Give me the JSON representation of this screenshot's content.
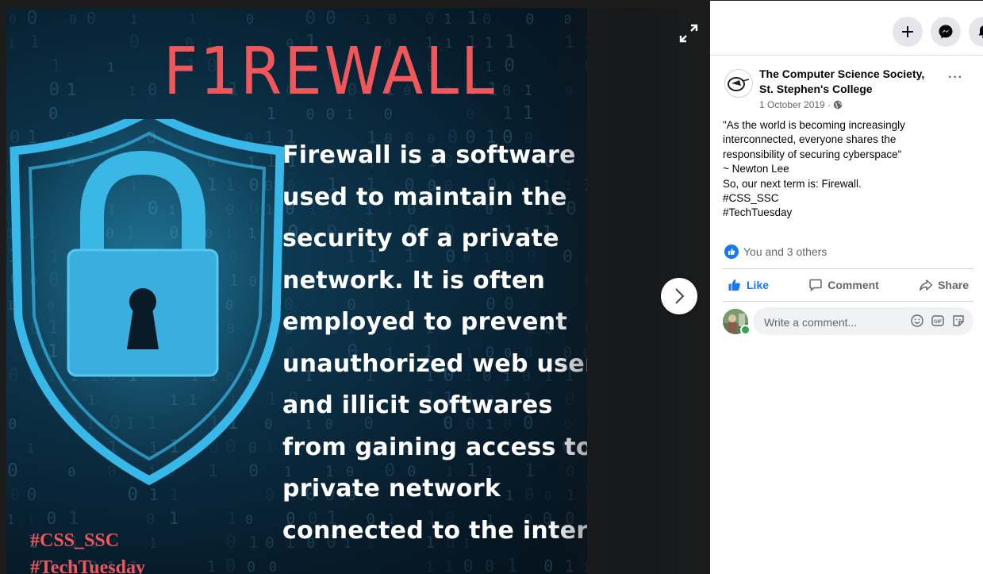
{
  "poster": {
    "title": "F1REWALL",
    "body_lines": [
      "Firewall is a software",
      "used to maintain the",
      "security of a private",
      "network. It is often",
      "employed to prevent",
      "unauthorized web users",
      "and illicit softwares",
      "from gaining access to a",
      "private network",
      "connected to the internet"
    ],
    "tags": [
      "#CSS_SSC",
      "#TechTuesday"
    ]
  },
  "viewer": {
    "expand_icon": "expand-icon",
    "next_icon": "chevron-right-icon"
  },
  "topbar": {
    "icons": [
      "plus-icon",
      "messenger-icon",
      "bell-icon"
    ]
  },
  "post": {
    "page_name": "The Computer Science Society, St. Stephen's College",
    "date": "1 October 2019 ·",
    "privacy_icon": "globe-icon",
    "more_label": "···",
    "text_lines": [
      "\"As the world is becoming increasingly",
      "interconnected, everyone shares the",
      "responsibility of securing cyberspace\"",
      "~ Newton Lee",
      "So, our next term is: Firewall.",
      "#CSS_SSC",
      "#TechTuesday"
    ],
    "reactions_text": "You and 3 others",
    "actions": {
      "like": "Like",
      "comment": "Comment",
      "share": "Share"
    },
    "comment_placeholder": "Write a comment..."
  },
  "colors": {
    "accent": "#1877f2",
    "poster_red": "#f0575a",
    "online": "#31a24c"
  }
}
